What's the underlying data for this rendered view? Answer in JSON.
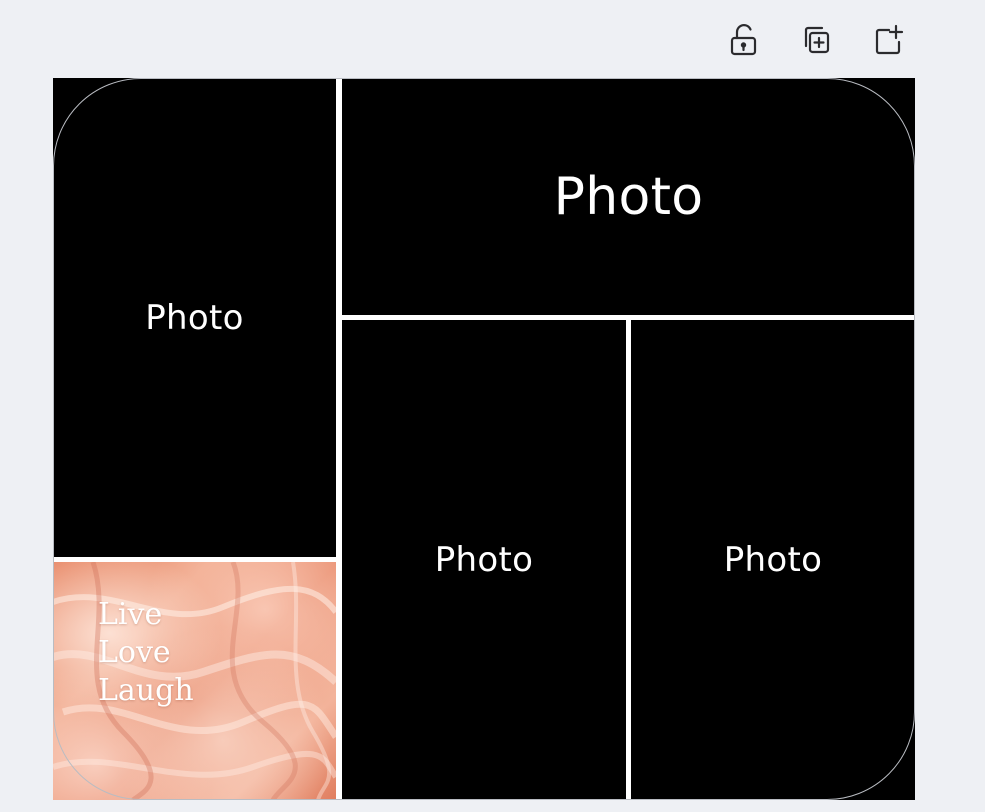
{
  "toolbar": {
    "lock_icon": "unlock-icon",
    "duplicate_icon": "duplicate-icon",
    "add_page_icon": "add-page-icon"
  },
  "collage": {
    "cells": [
      {
        "id": "left-top",
        "label": "Photo"
      },
      {
        "id": "top-right",
        "label": "Photo"
      },
      {
        "id": "mid-left",
        "label": "Photo"
      },
      {
        "id": "mid-right",
        "label": "Photo"
      }
    ],
    "quote_cell": {
      "lines": [
        "Live",
        "Love",
        "Laugh"
      ],
      "background": "peach-tulle-fabric"
    }
  },
  "colors": {
    "background": "#eef0f4",
    "cell": "#000000",
    "cell_text": "#ffffff",
    "quote_text": "#ffffff",
    "accent_peach": "#e98f6f"
  }
}
